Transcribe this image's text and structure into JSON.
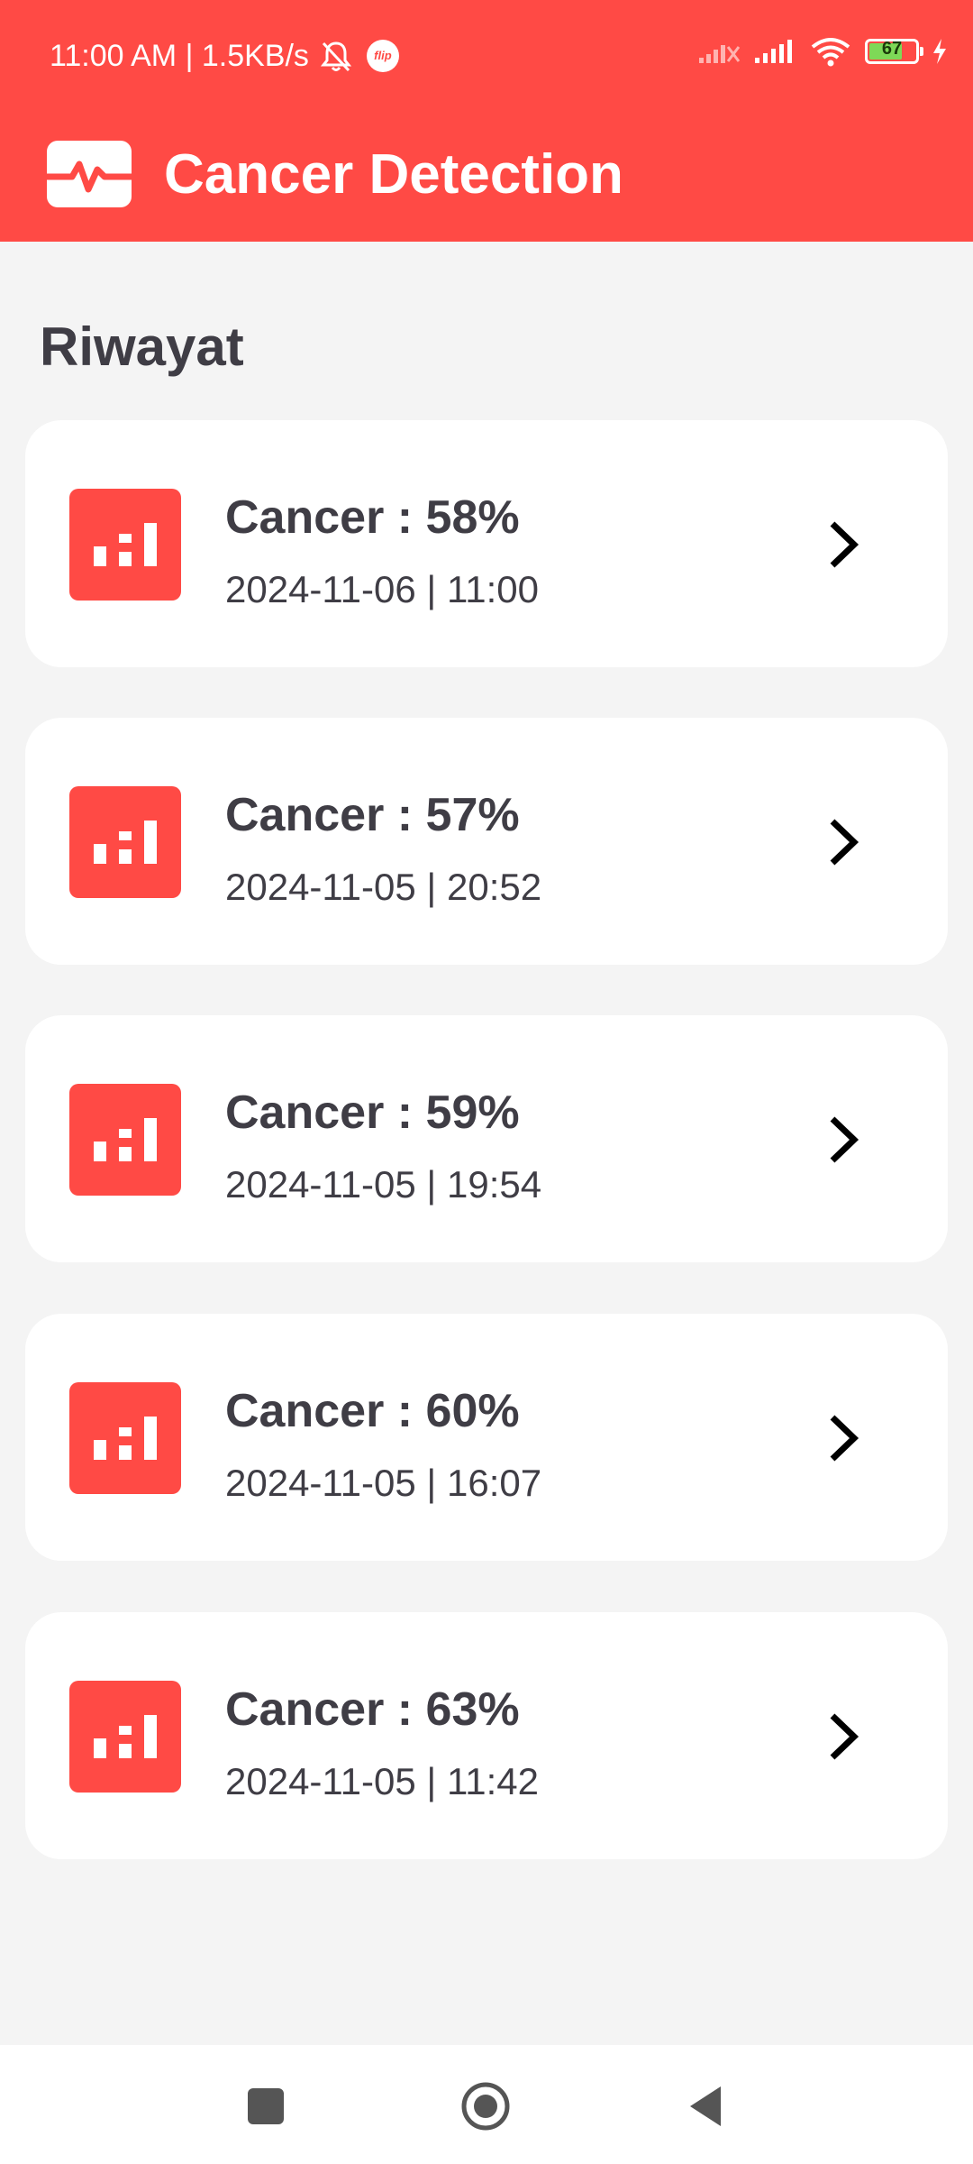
{
  "status_bar": {
    "left_text": "11:00 AM | 1.5KB/s",
    "flip_badge": "flip",
    "battery_level": "67"
  },
  "app_bar": {
    "title": "Cancer Detection",
    "icon": "heartbeat-icon"
  },
  "history": {
    "title": "Riwayat",
    "items": [
      {
        "result": "Cancer : 58%",
        "datetime": "2024-11-06 | 11:00"
      },
      {
        "result": "Cancer : 57%",
        "datetime": "2024-11-05 | 20:52"
      },
      {
        "result": "Cancer : 59%",
        "datetime": "2024-11-05 | 19:54"
      },
      {
        "result": "Cancer : 60%",
        "datetime": "2024-11-05 | 16:07"
      },
      {
        "result": "Cancer : 63%",
        "datetime": "2024-11-05 | 11:42"
      }
    ]
  },
  "colors": {
    "accent": "#ff4a45",
    "text": "#3f3d45",
    "background": "#f4f4f4"
  }
}
